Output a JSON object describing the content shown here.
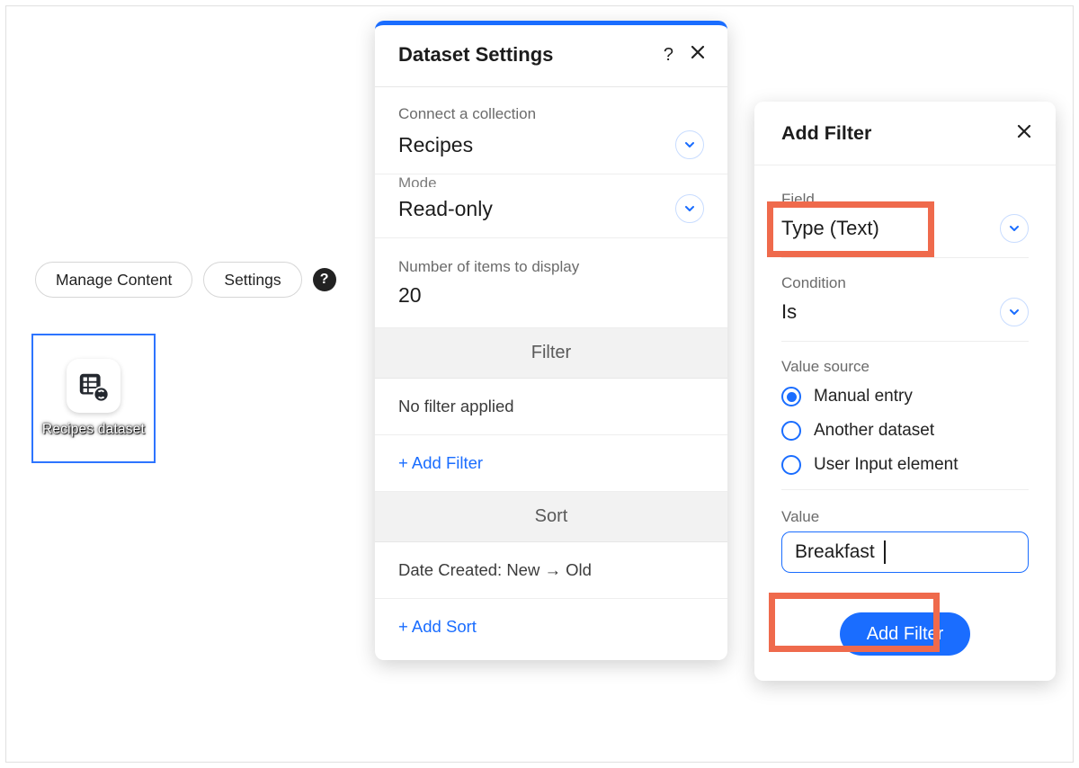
{
  "top_buttons": {
    "manage_content": "Manage Content",
    "settings": "Settings"
  },
  "dataset_tile": {
    "label": "Recipes dataset"
  },
  "dataset_settings": {
    "title": "Dataset Settings",
    "connect_label": "Connect a collection",
    "connect_value": "Recipes",
    "mode_label_cut": "Mode",
    "mode_value": "Read-only",
    "items_label": "Number of items to display",
    "items_value": "20",
    "filter_header": "Filter",
    "filter_status": "No filter applied",
    "add_filter": "+ Add Filter",
    "sort_header": "Sort",
    "sort_status": "Date Created: New → Old",
    "add_sort": "+ Add Sort"
  },
  "add_filter": {
    "title": "Add Filter",
    "field_label": "Field",
    "field_value": "Type (Text)",
    "condition_label": "Condition",
    "condition_value": "Is",
    "value_source_label": "Value source",
    "value_source_options": {
      "manual": "Manual entry",
      "another": "Another dataset",
      "userinput": "User Input element"
    },
    "value_source_selected": "manual",
    "value_label": "Value",
    "value_input": "Breakfast",
    "submit": "Add Filter"
  }
}
